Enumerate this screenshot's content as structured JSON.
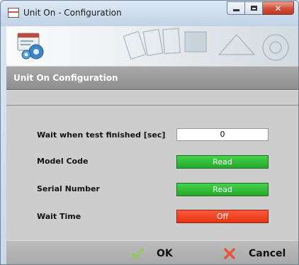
{
  "window": {
    "title": "Unit On - Configuration",
    "close_symbol": "✕"
  },
  "header": {
    "title": "Unit On Configuration"
  },
  "form": {
    "wait_label": "Wait when test finished [sec]",
    "wait_value": "0",
    "model_code_label": "Model Code",
    "model_code_button": "Read",
    "serial_number_label": "Serial Number",
    "serial_number_button": "Read",
    "wait_time_label": "Wait Time",
    "wait_time_button": "Off"
  },
  "footer": {
    "ok_label": "OK",
    "cancel_label": "Cancel"
  },
  "colors": {
    "read_button": "#2fbd35",
    "off_button": "#ef4422",
    "header_bar": "#9a9a9a",
    "ok_icon": "#8fcf4f",
    "cancel_icon": "#e8543a"
  },
  "icons": {
    "app": "window-app-icon",
    "logo": "gear-document-icon",
    "ok": "checkmark-icon",
    "cancel": "x-cross-icon"
  }
}
